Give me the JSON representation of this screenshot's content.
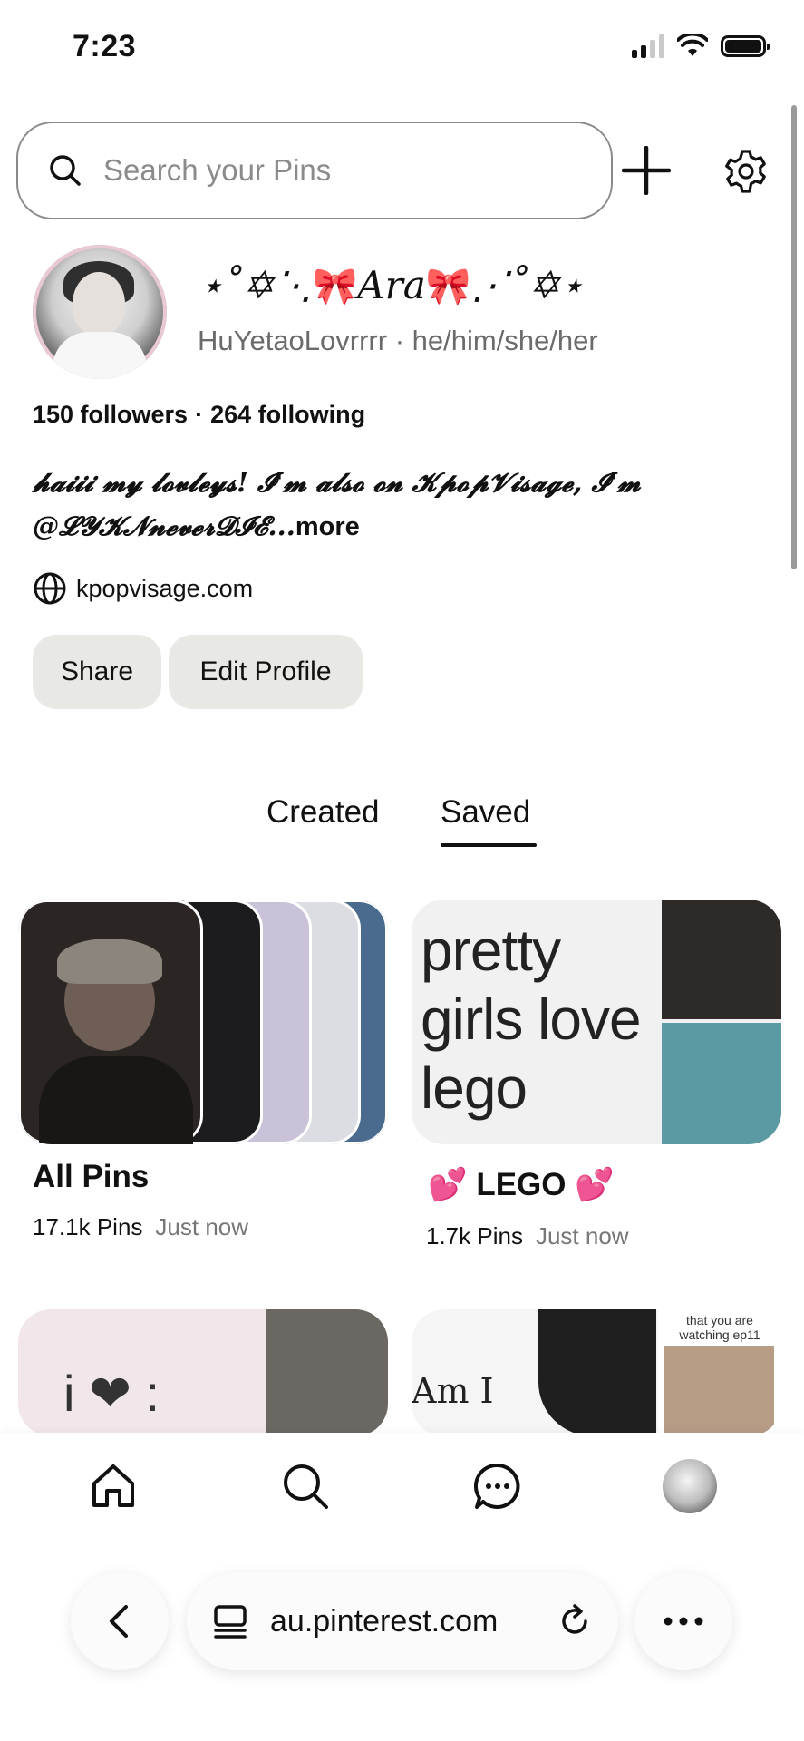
{
  "status_bar": {
    "time": "7:23"
  },
  "search": {
    "placeholder": "Search your Pins"
  },
  "profile": {
    "display_name": "Ara",
    "display_name_prefix": "⋆˚✡︎⋱",
    "display_name_suffix": "⋰˚✡︎⋆",
    "bow": "🎀",
    "username": "HuYetaoLovrrrr",
    "pronouns": "he/him/she/her",
    "separator": "·",
    "followers": "150 followers",
    "following": "264 following",
    "bio": "𝓱𝓪𝓲𝓲𝓲 𝓶𝔂 𝓵𝓸𝓿𝓵𝓮𝔂𝓼! 𝓘'𝓶 𝓪𝓵𝓼𝓸 𝓸𝓷 𝓚𝓹𝓸𝓹𝓥𝓲𝓼𝓪𝓰𝓮, 𝓘'𝓶 @𝓛𝓨𝓚𝓝𝓷𝓮𝓿𝓮𝓻𝓓𝓘𝓔...",
    "bio_more": "more",
    "website": "kpopvisage.com"
  },
  "buttons": {
    "share": "Share",
    "edit_profile": "Edit Profile"
  },
  "tabs": [
    {
      "label": "Created",
      "active": false
    },
    {
      "label": "Saved",
      "active": true
    }
  ],
  "boards": [
    {
      "title": "All Pins",
      "pins": "17.1k Pins",
      "updated": "Just now"
    },
    {
      "title": "LEGO",
      "title_emoji": "💕",
      "pins": "1.7k Pins",
      "updated": "Just now",
      "cover_text": "pretty girls love lego"
    },
    {
      "cover_text": "i ❤ :"
    },
    {
      "cover_text": "Am I",
      "cover_caption": "that you are watching ep11"
    }
  ],
  "browser": {
    "url": "au.pinterest.com"
  },
  "colors": {
    "button_bg": "#e8e8e4",
    "accent_pink": "#e56f93",
    "text": "#111111",
    "muted": "#6b6b6b"
  }
}
